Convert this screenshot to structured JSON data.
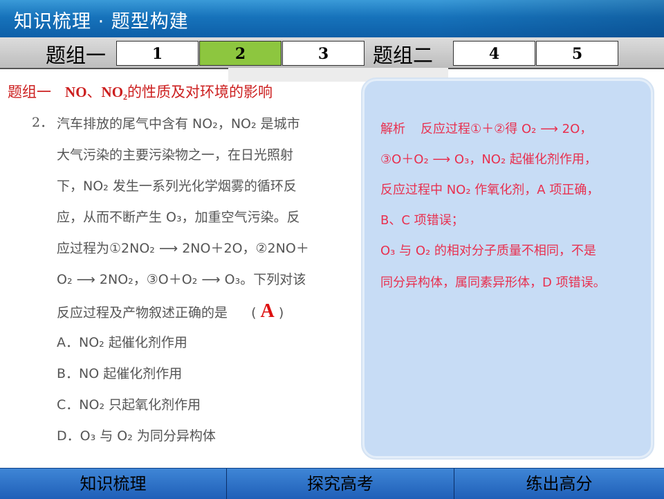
{
  "header": {
    "title": "知识梳理 · 题型构建"
  },
  "tabbar": {
    "group1_label": "题组一",
    "group2_label": "题组二",
    "tabs": [
      "1",
      "2",
      "3",
      "4",
      "5"
    ],
    "active_tab": "2"
  },
  "question": {
    "heading_prefix": "题组一",
    "heading_formula_1": "NO",
    "heading_sep": "、",
    "heading_formula_2": "NO",
    "heading_sub": "2",
    "heading_suffix": "的性质及对环境的影响",
    "number": "2．",
    "answer": "A",
    "lines": [
      "汽车排放的尾气中含有 NO₂，NO₂ 是城市",
      "大气污染的主要污染物之一，在日光照射",
      "下，NO₂ 发生一系列光化学烟雾的循环反",
      "应，从而不断产生 O₃，加重空气污染。反",
      "应过程为①2NO₂ ⟶ 2NO＋2O，②2NO＋",
      "O₂ ⟶ 2NO₂，③O＋O₂ ⟶ O₃。下列对该",
      "反应过程及产物叙述正确的是"
    ],
    "options": [
      {
        "letter": "A．",
        "text": "NO₂ 起催化剂作用"
      },
      {
        "letter": "B．",
        "text": "NO 起催化剂作用"
      },
      {
        "letter": "C．",
        "text": "NO₂ 只起氧化剂作用"
      },
      {
        "letter": "D．",
        "text": "O₃ 与 O₂ 为同分异构体"
      }
    ]
  },
  "explanation": {
    "label": "解析",
    "lines": [
      "反应过程①＋②得 O₂ ⟶ 2O，",
      "③O＋O₂ ⟶ O₃，NO₂ 起催化剂作用，",
      "反应过程中 NO₂ 作氧化剂，A 项正确，",
      "B、C 项错误；",
      "O₃ 与 O₂ 的相对分子质量不相同，不是",
      "同分异构体，属同素异形体，D 项错误。"
    ]
  },
  "footer": {
    "buttons": [
      "知识梳理",
      "探究高考",
      "练出高分"
    ]
  },
  "colors": {
    "header_blue": "#1773bb",
    "active_tab_green": "#8dc63f",
    "heading_red": "#cc1f1f",
    "explanation_pink": "#e8304f",
    "panel_blue": "#c7dcf5",
    "footer_blue": "#2a6fc4"
  }
}
